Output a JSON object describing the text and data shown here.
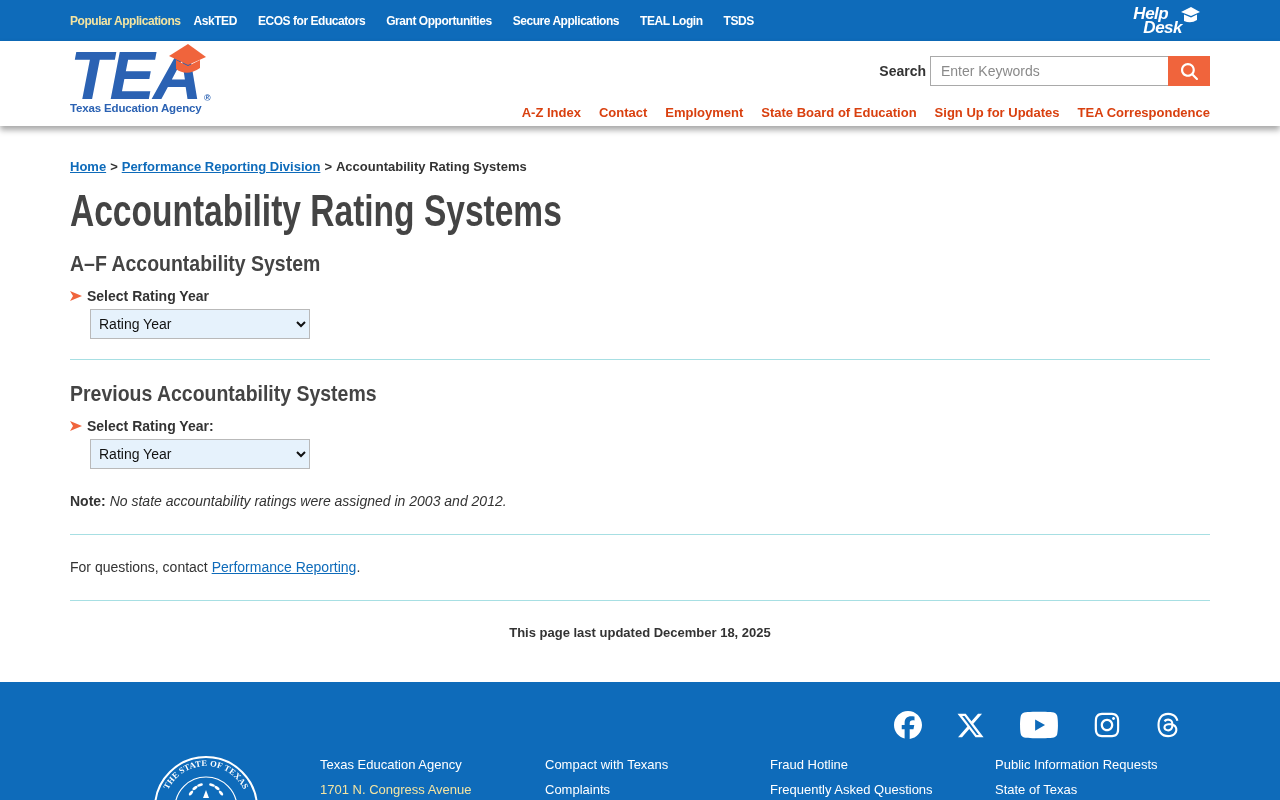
{
  "top_bar": {
    "nav": [
      {
        "text": "Popular Applications",
        "kind": "label"
      },
      {
        "text": "AskTED",
        "kind": "link"
      },
      {
        "text": "ECOS for Educators",
        "kind": "link"
      },
      {
        "text": "Grant Opportunities",
        "kind": "link"
      },
      {
        "text": "Secure Applications",
        "kind": "link"
      },
      {
        "text": "TEAL Login",
        "kind": "link"
      },
      {
        "text": "TSDS",
        "kind": "link"
      }
    ],
    "help_desk": {
      "lines": [
        "Help",
        "Desk"
      ]
    }
  },
  "header": {
    "logo": {
      "wordmark": "TEA",
      "registered": "®",
      "subtitle": "Texas Education Agency"
    },
    "search": {
      "label": "Search",
      "placeholder": "Enter Keywords"
    },
    "links": [
      "A-Z Index",
      "Contact",
      "Employment",
      "State Board of Education",
      "Sign Up for Updates",
      "TEA Correspondence"
    ]
  },
  "breadcrumb": [
    {
      "text": "Home",
      "kind": "link"
    },
    {
      "text": ">",
      "kind": "separator"
    },
    {
      "text": "Performance Reporting Division",
      "kind": "link"
    },
    {
      "text": ">",
      "kind": "separator"
    },
    {
      "text": "Accountability Rating Systems",
      "kind": "current"
    }
  ],
  "title": "Accountability Rating Systems",
  "sections": [
    {
      "heading": "A–F Accountability System",
      "label": "Select Rating Year",
      "select": {
        "value": "Rating Year"
      }
    },
    {
      "heading": "Previous Accountability Systems",
      "label": "Select Rating Year:",
      "select": {
        "value": "Rating Year"
      },
      "note": "**Note:** *No state accountability ratings were assigned in 2003 and 2012.*"
    }
  ],
  "contact": {
    "text": "For questions, contact ",
    "link": "Performance Reporting",
    "end": "."
  },
  "updated": "This page last updated December 18, 2025",
  "footer": {
    "seal": {
      "text": "THE STATE OF TEXAS"
    },
    "columns": [
      [
        {
          "text": "Texas Education Agency",
          "kind": "name"
        },
        {
          "text": "1701 N. Congress Avenue",
          "kind": "address"
        }
      ],
      [
        {
          "text": "Compact with Texans",
          "kind": "link"
        },
        {
          "text": "Complaints",
          "kind": "link"
        }
      ],
      [
        {
          "text": "Fraud Hotline",
          "kind": "link"
        },
        {
          "text": "Frequently Asked Questions",
          "kind": "link"
        }
      ],
      [
        {
          "text": "Public Information Requests",
          "kind": "link"
        },
        {
          "text": "State of Texas",
          "kind": "link"
        }
      ]
    ]
  }
}
